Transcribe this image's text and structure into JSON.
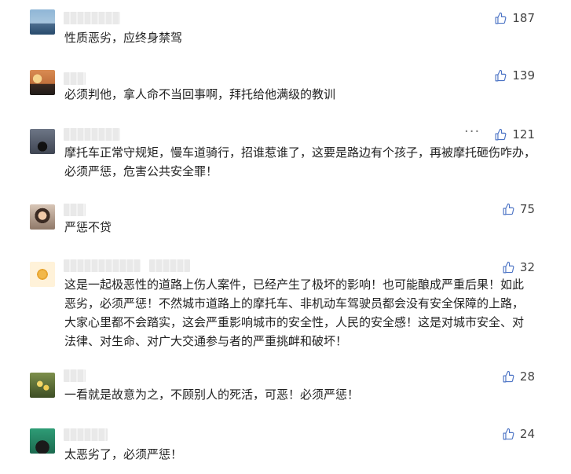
{
  "comments": [
    {
      "text": "性质恶劣，应终身禁驾",
      "likes": "187",
      "avatar_icon": "sunset-harbor-avatar"
    },
    {
      "text": "必须判他，拿人命不当回事啊，拜托给他满级的教训",
      "likes": "139",
      "avatar_icon": "sunset-sky-avatar"
    },
    {
      "text": "摩托车正常守规矩，慢车道骑行，招谁惹谁了，这要是路边有个孩子，再被摩托砸伤咋办，必须严惩，危害公共安全罪！",
      "likes": "121",
      "avatar_icon": "motorcycle-avatar",
      "menu": "···"
    },
    {
      "text": "严惩不贷",
      "likes": "75",
      "avatar_icon": "portrait-avatar"
    },
    {
      "text": "这是一起极恶性的道路上伤人案件，已经产生了极坏的影响！也可能酿成严重后果！如此恶劣，必须严惩！不然城市道路上的摩托车、非机动车驾驶员都会没有安全保障的上路，大家心里都不会踏实，这会严重影响城市的安全性，人民的安全感！这是对城市安全、对法律、对生命、对广大交通参与者的严重挑衅和破坏！",
      "likes": "32",
      "avatar_icon": "cartoon-avatar"
    },
    {
      "text": "一看就是故意为之，不顾别人的死活，可恶！必须严惩！",
      "likes": "28",
      "avatar_icon": "flowers-avatar"
    },
    {
      "text": "太恶劣了，必须严惩！",
      "likes": "24",
      "avatar_icon": "green-avatar"
    }
  ],
  "colors": {
    "text": "#222222",
    "like": "#444444",
    "name_blur": "#e9e9e9"
  },
  "icons": {
    "like": "thumbs-up-icon",
    "menu": "more-dots-icon"
  }
}
